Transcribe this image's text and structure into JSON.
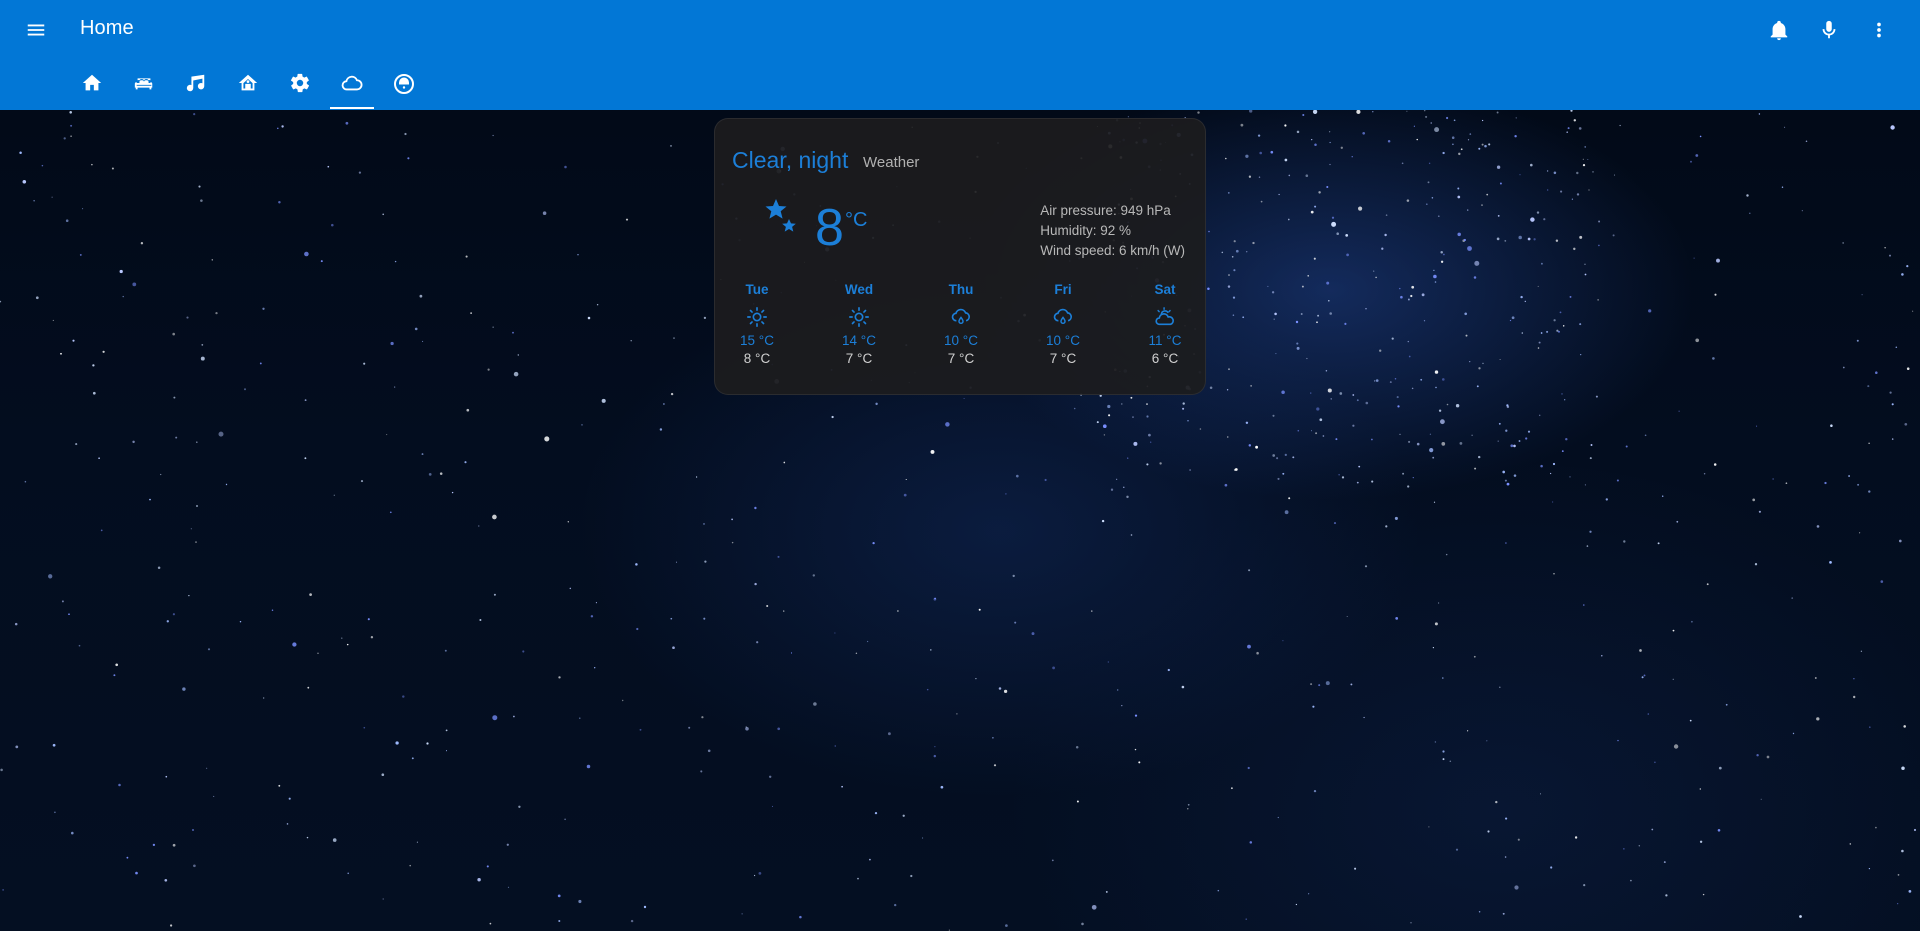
{
  "header": {
    "title": "Home",
    "menu_icon": "menu-icon",
    "actions": [
      "bell-icon",
      "microphone-icon",
      "dots-vertical-icon"
    ],
    "tabs": [
      {
        "icon": "home-icon",
        "active": false
      },
      {
        "icon": "sofa-icon",
        "active": false
      },
      {
        "icon": "music-icon",
        "active": false
      },
      {
        "icon": "house-icon",
        "active": false
      },
      {
        "icon": "gear-icon",
        "active": false
      },
      {
        "icon": "cloud-icon",
        "active": true
      },
      {
        "icon": "robot-vacuum-icon",
        "active": false
      }
    ],
    "accent_color": "#0277d6"
  },
  "weather": {
    "state": "Clear, night",
    "name": "Weather",
    "current_icon": "moon-stars-icon",
    "temperature": "8",
    "unit": "°C",
    "air_pressure": "Air pressure: 949 hPa",
    "humidity": "Humidity: 92 %",
    "wind_speed": "Wind speed: 6 km/h (W)",
    "forecast": [
      {
        "day": "Tue",
        "icon": "sunny-icon",
        "high": "15 °C",
        "low": "8 °C"
      },
      {
        "day": "Wed",
        "icon": "sunny-icon",
        "high": "14 °C",
        "low": "7 °C"
      },
      {
        "day": "Thu",
        "icon": "rain-cloud-icon",
        "high": "10 °C",
        "low": "7 °C"
      },
      {
        "day": "Fri",
        "icon": "rain-cloud-icon",
        "high": "10 °C",
        "low": "7 °C"
      },
      {
        "day": "Sat",
        "icon": "partly-cloudy-icon",
        "high": "11 °C",
        "low": "6 °C"
      }
    ]
  }
}
